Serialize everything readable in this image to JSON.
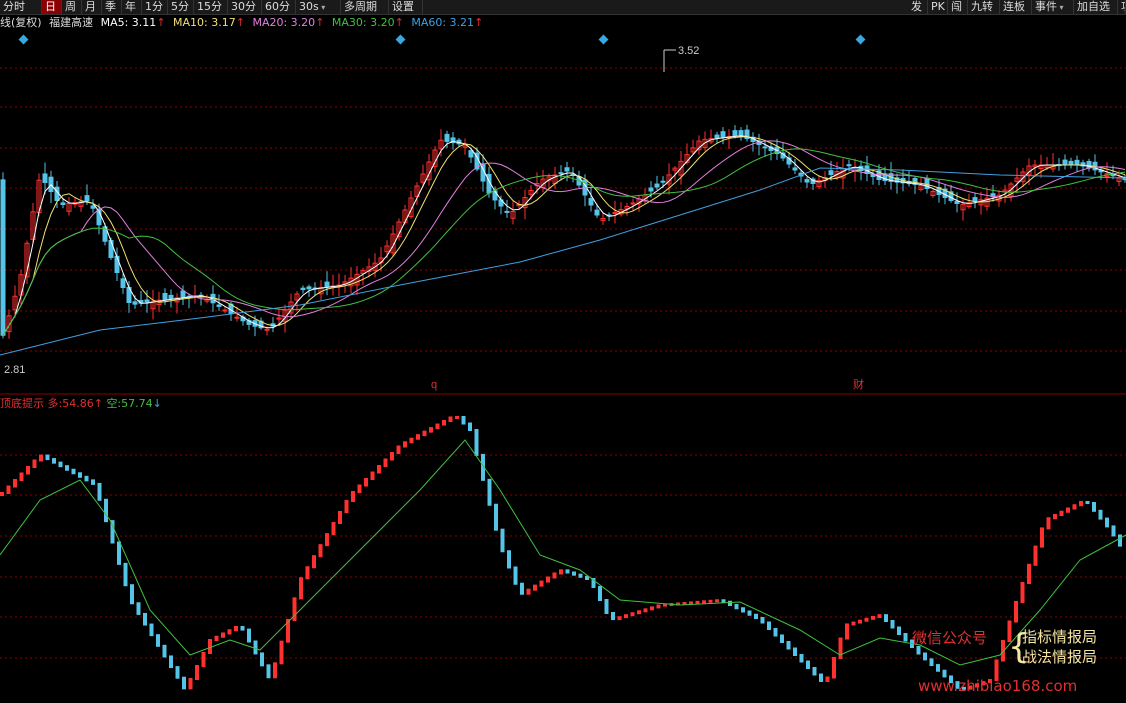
{
  "toolbar": {
    "left": [
      "分时",
      "日",
      "周",
      "月",
      "季",
      "年",
      "1分",
      "5分",
      "15分",
      "30分",
      "60分",
      "30s",
      "多周期",
      "设置"
    ],
    "active": "日",
    "right": [
      "发",
      "PK",
      "闯",
      "九转",
      "连板",
      "事件",
      "加自选"
    ],
    "right_cut": "功"
  },
  "ma_legend": {
    "prefix": "线(复权)",
    "stock": "福建高速",
    "items": [
      {
        "label": "MA5: 3.11",
        "color": "#ffffff"
      },
      {
        "label": "MA10: 3.17",
        "color": "#f0e070"
      },
      {
        "label": "MA20: 3.20",
        "color": "#e080e0"
      },
      {
        "label": "MA30: 3.20",
        "color": "#40c040"
      },
      {
        "label": "MA60: 3.21",
        "color": "#40a0e0"
      }
    ],
    "up_arrow": "↑"
  },
  "price_labels": {
    "high": "3.52",
    "low": "2.81"
  },
  "event_markers": {
    "q": "q",
    "cai": "财"
  },
  "indicator_legend": {
    "name": "顶底提示",
    "long_label": "多:",
    "long_value": "54.86",
    "long_arrow": "↑",
    "short_label": "空:",
    "short_value": "57.74",
    "short_arrow": "↓"
  },
  "watermark": {
    "left": "微信公众号",
    "right1": "指标情报局",
    "right2": "战法情报局",
    "url": "www.zhibiao168.com"
  },
  "colors": {
    "up": "#ff3030",
    "down": "#54c4e8",
    "ma5": "#ffffff",
    "ma10": "#f0e070",
    "ma20": "#e080e0",
    "ma30": "#40c040",
    "ma60": "#40a0e0",
    "grid": "#8b0000"
  }
}
